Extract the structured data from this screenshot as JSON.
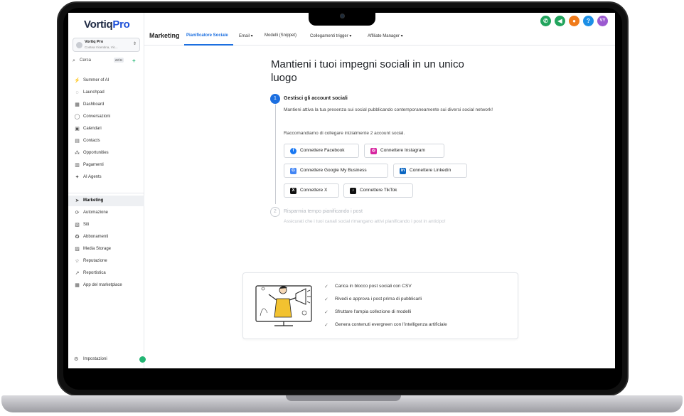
{
  "brand": {
    "logo_main": "Vortiq",
    "logo_accent": "Pro"
  },
  "account": {
    "name": "Vortiq Pro",
    "subtitle": "Contea Vicentina, Vic..."
  },
  "search": {
    "label": "Cerca",
    "shortcut": "ctrl K"
  },
  "sidebar": {
    "items": [
      {
        "label": "Summer of AI",
        "icon": "wand-icon"
      },
      {
        "label": "Launchpad",
        "icon": "rocket-icon"
      },
      {
        "label": "Dashboard",
        "icon": "grid-icon"
      },
      {
        "label": "Conversazioni",
        "icon": "chat-icon"
      },
      {
        "label": "Calendari",
        "icon": "calendar-icon"
      },
      {
        "label": "Contacts",
        "icon": "contacts-icon"
      },
      {
        "label": "Opportunities",
        "icon": "opportunities-icon"
      },
      {
        "label": "Pagamenti",
        "icon": "payments-icon"
      },
      {
        "label": "AI Agents",
        "icon": "sparkle-icon"
      }
    ],
    "items2": [
      {
        "label": "Marketing",
        "icon": "send-icon",
        "active": true
      },
      {
        "label": "Automazione",
        "icon": "automation-icon"
      },
      {
        "label": "Siti",
        "icon": "sites-icon"
      },
      {
        "label": "Abbonamenti",
        "icon": "badge-icon"
      },
      {
        "label": "Media Storage",
        "icon": "image-icon"
      },
      {
        "label": "Reputazione",
        "icon": "star-icon"
      },
      {
        "label": "Reportistica",
        "icon": "trend-icon"
      },
      {
        "label": "App del marketplace",
        "icon": "apps-icon"
      }
    ],
    "settings": "Impostazioni"
  },
  "header": {
    "title": "Marketing",
    "tabs": [
      {
        "label": "Pianificatore Sociale",
        "active": true
      },
      {
        "label": "Email ▾"
      },
      {
        "label": "Modelli (Snippet)"
      },
      {
        "label": "Collegamenti trigger ▾"
      },
      {
        "label": "Affiliate Manager ▾"
      }
    ],
    "icons": [
      {
        "name": "phone-icon",
        "glyph": "✆",
        "color": "#22a45d"
      },
      {
        "name": "megaphone-icon",
        "glyph": "◀",
        "color": "#22a45d"
      },
      {
        "name": "bell-icon",
        "glyph": "●",
        "color": "#f07b1a"
      },
      {
        "name": "help-icon",
        "glyph": "?",
        "color": "#1c8fe6"
      },
      {
        "name": "avatar",
        "glyph": "VY",
        "color": "#9b59d0"
      }
    ]
  },
  "main": {
    "title": "Mantieni i tuoi impegni sociali in un unico luogo",
    "step1": {
      "number": "1",
      "title": "Gestisci gli account sociali",
      "description": "Mantieni attiva la tua presenza sui social pubblicando contemporaneamente sui diversi social network!",
      "recommend": "Raccomandiamo di collegare inizialmente 2 account social."
    },
    "buttons": [
      {
        "label": "Connettere Facebook",
        "icon": "facebook-icon",
        "color": "#1877f2",
        "glyph": "f"
      },
      {
        "label": "Connettere Instagram",
        "icon": "instagram-icon",
        "color": "#d6249f",
        "glyph": "◎"
      },
      {
        "label": "Connettere Google My Business",
        "icon": "google-business-icon",
        "color": "#4285f4",
        "glyph": "G"
      },
      {
        "label": "Connettere Linkedin",
        "icon": "linkedin-icon",
        "color": "#0a66c2",
        "glyph": "in"
      },
      {
        "label": "Connettere X",
        "icon": "x-icon",
        "color": "#111111",
        "glyph": "X"
      },
      {
        "label": "Connettere TikTok",
        "icon": "tiktok-icon",
        "color": "#111111",
        "glyph": "♪"
      }
    ],
    "step2": {
      "number": "2",
      "title": "Risparmia tempo pianificando i post",
      "description": "Assicurati che i tuoi canali social rimangano attivi pianificando i post in anticipo!"
    },
    "features": [
      "Carica in blocco post sociali con CSV",
      "Rivedi e approva i post prima di pubblicarli",
      "Sfruttare l'ampia collezione di modelli",
      "Genera contenuti evergreen con l'intelligenza artificiale"
    ]
  }
}
